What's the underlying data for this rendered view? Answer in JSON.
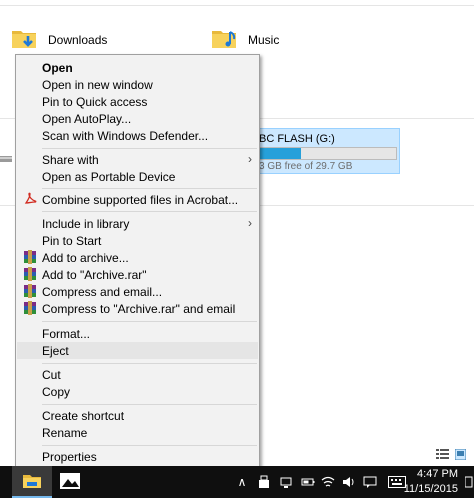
{
  "explorer": {
    "folders": [
      {
        "name": "Downloads"
      },
      {
        "name": "Music"
      }
    ],
    "drive": {
      "name_partial": "BC FLASH (G:)",
      "free_partial": "3 GB free of 29.7 GB",
      "used_fraction": 0.3
    }
  },
  "context_menu": {
    "items": {
      "open": "Open",
      "open_new_window": "Open in new window",
      "pin_quick_access": "Pin to Quick access",
      "open_autoplay": "Open AutoPlay...",
      "scan_defender": "Scan with Windows Defender...",
      "share_with": "Share with",
      "open_portable": "Open as Portable Device",
      "combine_acrobat": "Combine supported files in Acrobat...",
      "include_library": "Include in library",
      "pin_start": "Pin to Start",
      "add_archive": "Add to archive...",
      "add_archive_rar": "Add to \"Archive.rar\"",
      "compress_email": "Compress and email...",
      "compress_rar_email": "Compress to \"Archive.rar\" and email",
      "format": "Format...",
      "eject": "Eject",
      "cut": "Cut",
      "copy": "Copy",
      "create_shortcut": "Create shortcut",
      "rename": "Rename",
      "properties": "Properties"
    }
  },
  "taskbar": {
    "time": "4:47 PM",
    "date": "11/15/2015"
  },
  "colors": {
    "selection": "#cce8ff",
    "progress": "#26a0da",
    "taskbar": "#0f0f0f",
    "menu_bg": "#f2f2f2"
  }
}
